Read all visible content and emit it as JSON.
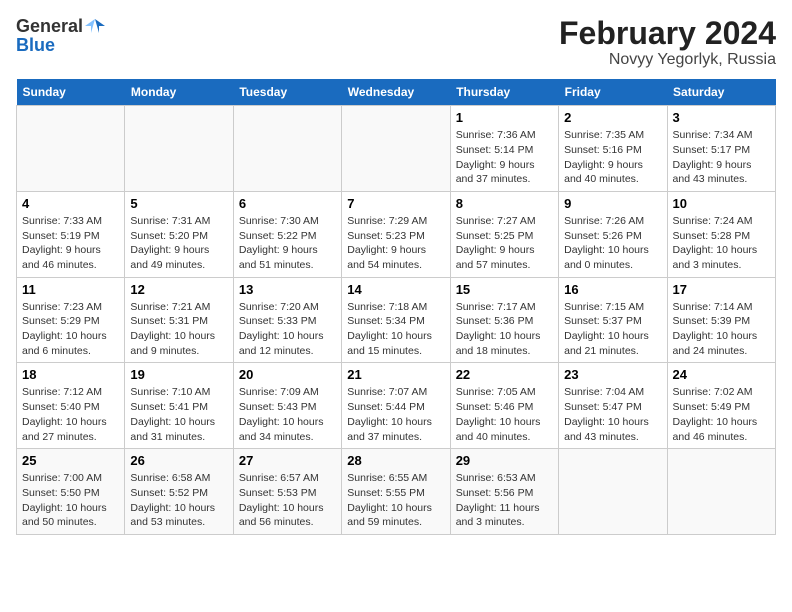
{
  "header": {
    "logo_general": "General",
    "logo_blue": "Blue",
    "main_title": "February 2024",
    "subtitle": "Novyy Yegorlyk, Russia"
  },
  "days_of_week": [
    "Sunday",
    "Monday",
    "Tuesday",
    "Wednesday",
    "Thursday",
    "Friday",
    "Saturday"
  ],
  "weeks": [
    [
      {
        "day": null
      },
      {
        "day": null
      },
      {
        "day": null
      },
      {
        "day": null
      },
      {
        "day": 1,
        "sunrise": "Sunrise: 7:36 AM",
        "sunset": "Sunset: 5:14 PM",
        "daylight": "Daylight: 9 hours and 37 minutes."
      },
      {
        "day": 2,
        "sunrise": "Sunrise: 7:35 AM",
        "sunset": "Sunset: 5:16 PM",
        "daylight": "Daylight: 9 hours and 40 minutes."
      },
      {
        "day": 3,
        "sunrise": "Sunrise: 7:34 AM",
        "sunset": "Sunset: 5:17 PM",
        "daylight": "Daylight: 9 hours and 43 minutes."
      }
    ],
    [
      {
        "day": 4,
        "sunrise": "Sunrise: 7:33 AM",
        "sunset": "Sunset: 5:19 PM",
        "daylight": "Daylight: 9 hours and 46 minutes."
      },
      {
        "day": 5,
        "sunrise": "Sunrise: 7:31 AM",
        "sunset": "Sunset: 5:20 PM",
        "daylight": "Daylight: 9 hours and 49 minutes."
      },
      {
        "day": 6,
        "sunrise": "Sunrise: 7:30 AM",
        "sunset": "Sunset: 5:22 PM",
        "daylight": "Daylight: 9 hours and 51 minutes."
      },
      {
        "day": 7,
        "sunrise": "Sunrise: 7:29 AM",
        "sunset": "Sunset: 5:23 PM",
        "daylight": "Daylight: 9 hours and 54 minutes."
      },
      {
        "day": 8,
        "sunrise": "Sunrise: 7:27 AM",
        "sunset": "Sunset: 5:25 PM",
        "daylight": "Daylight: 9 hours and 57 minutes."
      },
      {
        "day": 9,
        "sunrise": "Sunrise: 7:26 AM",
        "sunset": "Sunset: 5:26 PM",
        "daylight": "Daylight: 10 hours and 0 minutes."
      },
      {
        "day": 10,
        "sunrise": "Sunrise: 7:24 AM",
        "sunset": "Sunset: 5:28 PM",
        "daylight": "Daylight: 10 hours and 3 minutes."
      }
    ],
    [
      {
        "day": 11,
        "sunrise": "Sunrise: 7:23 AM",
        "sunset": "Sunset: 5:29 PM",
        "daylight": "Daylight: 10 hours and 6 minutes."
      },
      {
        "day": 12,
        "sunrise": "Sunrise: 7:21 AM",
        "sunset": "Sunset: 5:31 PM",
        "daylight": "Daylight: 10 hours and 9 minutes."
      },
      {
        "day": 13,
        "sunrise": "Sunrise: 7:20 AM",
        "sunset": "Sunset: 5:33 PM",
        "daylight": "Daylight: 10 hours and 12 minutes."
      },
      {
        "day": 14,
        "sunrise": "Sunrise: 7:18 AM",
        "sunset": "Sunset: 5:34 PM",
        "daylight": "Daylight: 10 hours and 15 minutes."
      },
      {
        "day": 15,
        "sunrise": "Sunrise: 7:17 AM",
        "sunset": "Sunset: 5:36 PM",
        "daylight": "Daylight: 10 hours and 18 minutes."
      },
      {
        "day": 16,
        "sunrise": "Sunrise: 7:15 AM",
        "sunset": "Sunset: 5:37 PM",
        "daylight": "Daylight: 10 hours and 21 minutes."
      },
      {
        "day": 17,
        "sunrise": "Sunrise: 7:14 AM",
        "sunset": "Sunset: 5:39 PM",
        "daylight": "Daylight: 10 hours and 24 minutes."
      }
    ],
    [
      {
        "day": 18,
        "sunrise": "Sunrise: 7:12 AM",
        "sunset": "Sunset: 5:40 PM",
        "daylight": "Daylight: 10 hours and 27 minutes."
      },
      {
        "day": 19,
        "sunrise": "Sunrise: 7:10 AM",
        "sunset": "Sunset: 5:41 PM",
        "daylight": "Daylight: 10 hours and 31 minutes."
      },
      {
        "day": 20,
        "sunrise": "Sunrise: 7:09 AM",
        "sunset": "Sunset: 5:43 PM",
        "daylight": "Daylight: 10 hours and 34 minutes."
      },
      {
        "day": 21,
        "sunrise": "Sunrise: 7:07 AM",
        "sunset": "Sunset: 5:44 PM",
        "daylight": "Daylight: 10 hours and 37 minutes."
      },
      {
        "day": 22,
        "sunrise": "Sunrise: 7:05 AM",
        "sunset": "Sunset: 5:46 PM",
        "daylight": "Daylight: 10 hours and 40 minutes."
      },
      {
        "day": 23,
        "sunrise": "Sunrise: 7:04 AM",
        "sunset": "Sunset: 5:47 PM",
        "daylight": "Daylight: 10 hours and 43 minutes."
      },
      {
        "day": 24,
        "sunrise": "Sunrise: 7:02 AM",
        "sunset": "Sunset: 5:49 PM",
        "daylight": "Daylight: 10 hours and 46 minutes."
      }
    ],
    [
      {
        "day": 25,
        "sunrise": "Sunrise: 7:00 AM",
        "sunset": "Sunset: 5:50 PM",
        "daylight": "Daylight: 10 hours and 50 minutes."
      },
      {
        "day": 26,
        "sunrise": "Sunrise: 6:58 AM",
        "sunset": "Sunset: 5:52 PM",
        "daylight": "Daylight: 10 hours and 53 minutes."
      },
      {
        "day": 27,
        "sunrise": "Sunrise: 6:57 AM",
        "sunset": "Sunset: 5:53 PM",
        "daylight": "Daylight: 10 hours and 56 minutes."
      },
      {
        "day": 28,
        "sunrise": "Sunrise: 6:55 AM",
        "sunset": "Sunset: 5:55 PM",
        "daylight": "Daylight: 10 hours and 59 minutes."
      },
      {
        "day": 29,
        "sunrise": "Sunrise: 6:53 AM",
        "sunset": "Sunset: 5:56 PM",
        "daylight": "Daylight: 11 hours and 3 minutes."
      },
      {
        "day": null
      },
      {
        "day": null
      }
    ]
  ]
}
